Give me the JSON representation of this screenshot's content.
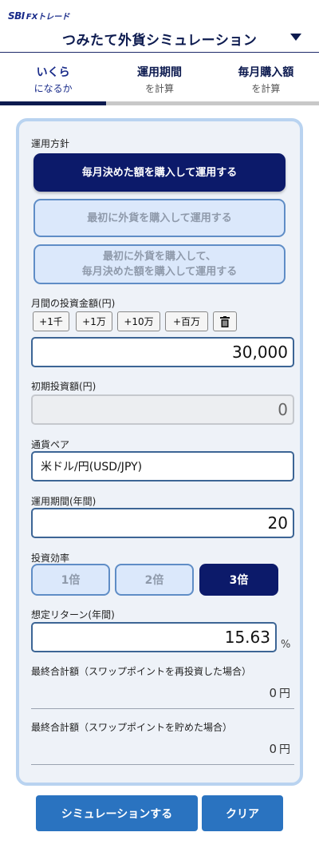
{
  "header": {
    "logo_sbi": "SBI",
    "logo_fx": "FXトレード",
    "title": "つみたて外貨シミュレーション"
  },
  "tabs": [
    {
      "line1": "いくら",
      "line2": "になるか",
      "active": true
    },
    {
      "line1": "運用期間",
      "line2": "を計算",
      "active": false
    },
    {
      "line1": "毎月購入額",
      "line2": "を計算",
      "active": false
    }
  ],
  "form": {
    "policy_label": "運用方針",
    "policies": [
      {
        "line1": "毎月決めた額を購入して運用する",
        "line2": "",
        "active": true
      },
      {
        "line1": "最初に外貨を購入して運用する",
        "line2": "",
        "active": false
      },
      {
        "line1": "最初に外貨を購入して、",
        "line2": "毎月決めた額を購入して運用する",
        "active": false
      }
    ],
    "monthly_label": "月間の投資金額(円)",
    "quick_buttons": [
      "+1千",
      "+1万",
      "+10万",
      "+百万"
    ],
    "monthly_value": "30,000",
    "initial_label": "初期投資額(円)",
    "initial_value": "0",
    "pair_label": "通貨ペア",
    "pair_value": "米ドル/円(USD/JPY)",
    "period_label": "運用期間(年間)",
    "period_value": "20",
    "efficiency_label": "投資効率",
    "efficiency_options": [
      "1倍",
      "2倍",
      "3倍"
    ],
    "efficiency_selected": 2,
    "return_label": "想定リターン(年間)",
    "return_value": "15.63",
    "return_unit": "%",
    "result1_label": "最終合計額（スワップポイントを再投資した場合）",
    "result1_value": "0",
    "result2_label": "最終合計額（スワップポイントを貯めた場合）",
    "result2_value": "0",
    "yen_unit": "円"
  },
  "actions": {
    "simulate": "シミュレーションする",
    "clear": "クリア"
  },
  "colors": {
    "navy": "#0c1a6a",
    "panel_border": "#b9d3f0",
    "button_blue": "#2a73c0"
  }
}
